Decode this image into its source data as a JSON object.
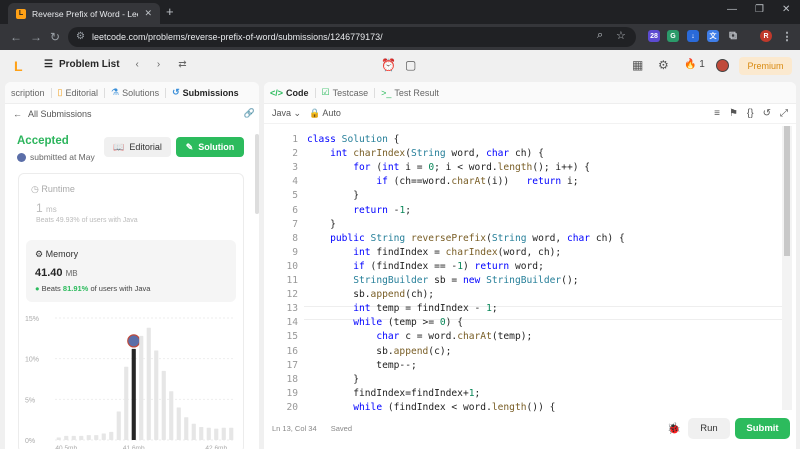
{
  "browser": {
    "tab_title": "Reverse Prefix of Word - LeetC...",
    "url": "leetcode.com/problems/reverse-prefix-of-word/submissions/1246779173/",
    "ext_badge": "28",
    "profile_initial": "R"
  },
  "header": {
    "logo": "L",
    "problem_list": "Problem List",
    "streak": "1",
    "premium": "Premium"
  },
  "left_tabs": [
    {
      "label": "scription"
    },
    {
      "label": "Editorial"
    },
    {
      "label": "Solutions"
    },
    {
      "label": "Submissions"
    }
  ],
  "all_submissions": "All Submissions",
  "result": {
    "status": "Accepted",
    "submitted": "submitted at May",
    "editorial_btn": "Editorial",
    "solution_btn": "Solution"
  },
  "runtime": {
    "label": "Runtime",
    "value": "1",
    "unit": "ms",
    "beats_prefix": "Beats",
    "beats_pct": "49.93%",
    "beats_suffix": "of users with Java"
  },
  "memory": {
    "label": "Memory",
    "value": "41.40",
    "unit": "MB",
    "beats_prefix": "Beats",
    "beats_pct": "81.91%",
    "beats_suffix": "of users with Java"
  },
  "chart_data": {
    "type": "bar",
    "yticks": [
      "15%",
      "10%",
      "5%",
      "0%"
    ],
    "xticks": [
      "40.5mb",
      "41.6mb",
      "42.6mb"
    ],
    "ylim": [
      0,
      15
    ],
    "values": [
      0.3,
      0.5,
      0.5,
      0.5,
      0.6,
      0.6,
      0.8,
      1.0,
      3.5,
      9.0,
      11.2,
      12.8,
      13.8,
      11.0,
      8.5,
      6.0,
      4.0,
      2.8,
      2.0,
      1.6,
      1.5,
      1.4,
      1.5,
      1.5
    ],
    "highlight_index": 10
  },
  "right_tabs": [
    {
      "label": "Code"
    },
    {
      "label": "Testcase"
    },
    {
      "label": "Test Result"
    }
  ],
  "editor": {
    "language": "Java",
    "mode": "Auto",
    "status_pos": "Ln 13, Col 34",
    "status_saved": "Saved",
    "run": "Run",
    "submit": "Submit"
  },
  "code_lines": [
    "class Solution {",
    "    int charIndex(String word, char ch) {",
    "        for (int i = 0; i < word.length(); i++) {",
    "            if (ch==word.charAt(i))   return i;",
    "        }",
    "        return -1;",
    "    }",
    "    public String reversePrefix(String word, char ch) {",
    "        int findIndex = charIndex(word, ch);",
    "        if (findIndex == -1) return word;",
    "        StringBuilder sb = new StringBuilder();",
    "        sb.append(ch);",
    "        int temp = findIndex - 1;",
    "        while (temp >= 0) {",
    "            char c = word.charAt(temp);",
    "            sb.append(c);",
    "            temp--;",
    "        }",
    "        findIndex=findIndex+1;",
    "        while (findIndex < word.length()) {"
  ]
}
